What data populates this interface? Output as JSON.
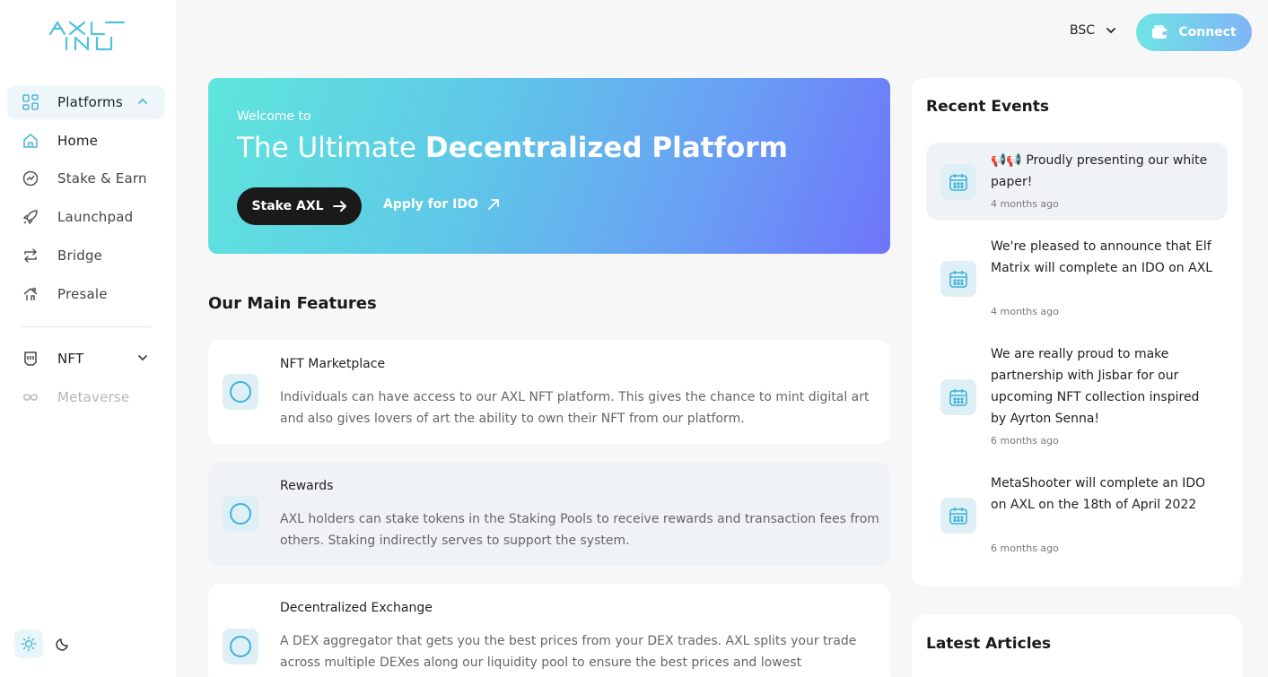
{
  "brand": {
    "logo_text": "AXL INU",
    "accent": "#5bc8e0"
  },
  "sidebar": {
    "items": [
      {
        "label": "Platforms",
        "icon": "grid-icon"
      },
      {
        "label": "Home",
        "icon": "home-icon"
      },
      {
        "label": "Stake & Earn",
        "icon": "chart-icon"
      },
      {
        "label": "Launchpad",
        "icon": "rocket-icon"
      },
      {
        "label": "Bridge",
        "icon": "swap-icon"
      },
      {
        "label": "Presale",
        "icon": "presale-icon"
      },
      {
        "label": "NFT",
        "icon": "nft-icon"
      },
      {
        "label": "Metaverse",
        "icon": "infinity-icon"
      }
    ]
  },
  "header": {
    "chain": "BSC",
    "connect_label": "Connect"
  },
  "hero": {
    "welcome": "Welcome to",
    "headline_light": "The Ultimate ",
    "headline_bold": "Decentralized Platform",
    "stake_label": "Stake AXL",
    "ido_label": "Apply for IDO"
  },
  "features": {
    "title": "Our Main Features",
    "items": [
      {
        "title": "NFT Marketplace",
        "desc": "Individuals can have access to our AXL NFT platform. This gives the chance to mint digital art and also gives lovers of art the ability to own their NFT from our platform."
      },
      {
        "title": "Rewards",
        "desc": "AXL holders can stake tokens in the Staking Pools to receive rewards and transaction fees from others. Staking indirectly serves to support the system."
      },
      {
        "title": "Decentralized Exchange",
        "desc": "A DEX aggregator that gets you the best prices from your DEX trades. AXL splits your trade across multiple DEXes along our liquidity pool to ensure the best prices and lowest"
      }
    ]
  },
  "events": {
    "title": "Recent Events",
    "items": [
      {
        "text": "📢📢 Proudly presenting our white paper!",
        "time": "4 months ago"
      },
      {
        "text": "We're pleased to announce that Elf Matrix will complete an IDO on AXL",
        "time": "4 months ago"
      },
      {
        "text": "We are really proud to make partnership with Jisbar for our upcoming NFT collection inspired by Ayrton Senna!",
        "time": "6 months ago"
      },
      {
        "text": "MetaShooter will complete an IDO on AXL on the 18th of April 2022",
        "time": "6 months ago"
      }
    ]
  },
  "articles": {
    "title": "Latest Articles"
  }
}
